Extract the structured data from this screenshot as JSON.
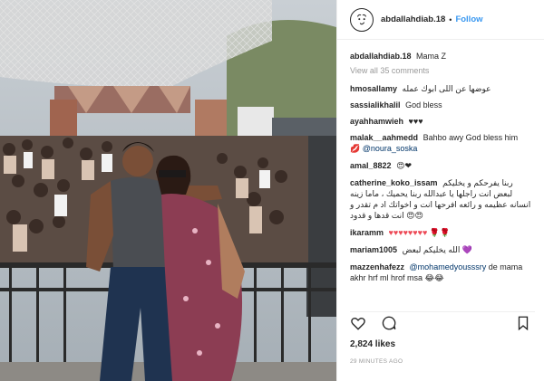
{
  "post": {
    "username": "abdallahdiab.18",
    "separator": "•",
    "follow_label": "Follow",
    "caption_user": "abdallahdiab.18",
    "caption_text": "Mama Z",
    "view_all": "View all 35 comments",
    "likes": "2,824 likes",
    "time": "29 MINUTES AGO"
  },
  "comments": [
    {
      "user": "hmosallamy",
      "text": "عوضها عن اللى ابوك عمله"
    },
    {
      "user": "sassialikhalil",
      "text": "God bless"
    },
    {
      "user": "ayahhamwieh",
      "text": "♥♥♥"
    },
    {
      "user": "malak__aahmedd",
      "text": "Bahbo awy God bless him",
      "mention": "@noura_soska",
      "emoji": "💋"
    },
    {
      "user": "amal_8822",
      "text": "😍❤"
    },
    {
      "user": "catherine_koko_issam",
      "text": "ربنا يفرحكم و يخليكم لبعض انت راجلها يا عبدالله ربنا يحميك ، ماما زينه انسانه عظيمه و رائعه افرحها انت و اخواتك اد م تقدر و انت قدها و قدود",
      "emoji": "😍😍"
    },
    {
      "user": "ikaramm",
      "text": "♥♥♥♥♥♥♥♥",
      "emoji": "🌹🌹"
    },
    {
      "user": "mariam1005",
      "text": "الله يخليكم لبعض",
      "emoji": "💜"
    },
    {
      "user": "mazzenhafezz",
      "mention": "@mohamedyousssry",
      "text": "de mama akhr hrf ml hrof msa",
      "emoji": "😂😂"
    }
  ],
  "icons": {
    "avatar": "stylized-face-logo-icon",
    "like": "heart-outline-icon",
    "comment": "speech-bubble-icon",
    "save": "bookmark-icon"
  },
  "colors": {
    "link_blue": "#3897f0",
    "text": "#262626",
    "muted": "#999999",
    "mention": "#003569"
  }
}
